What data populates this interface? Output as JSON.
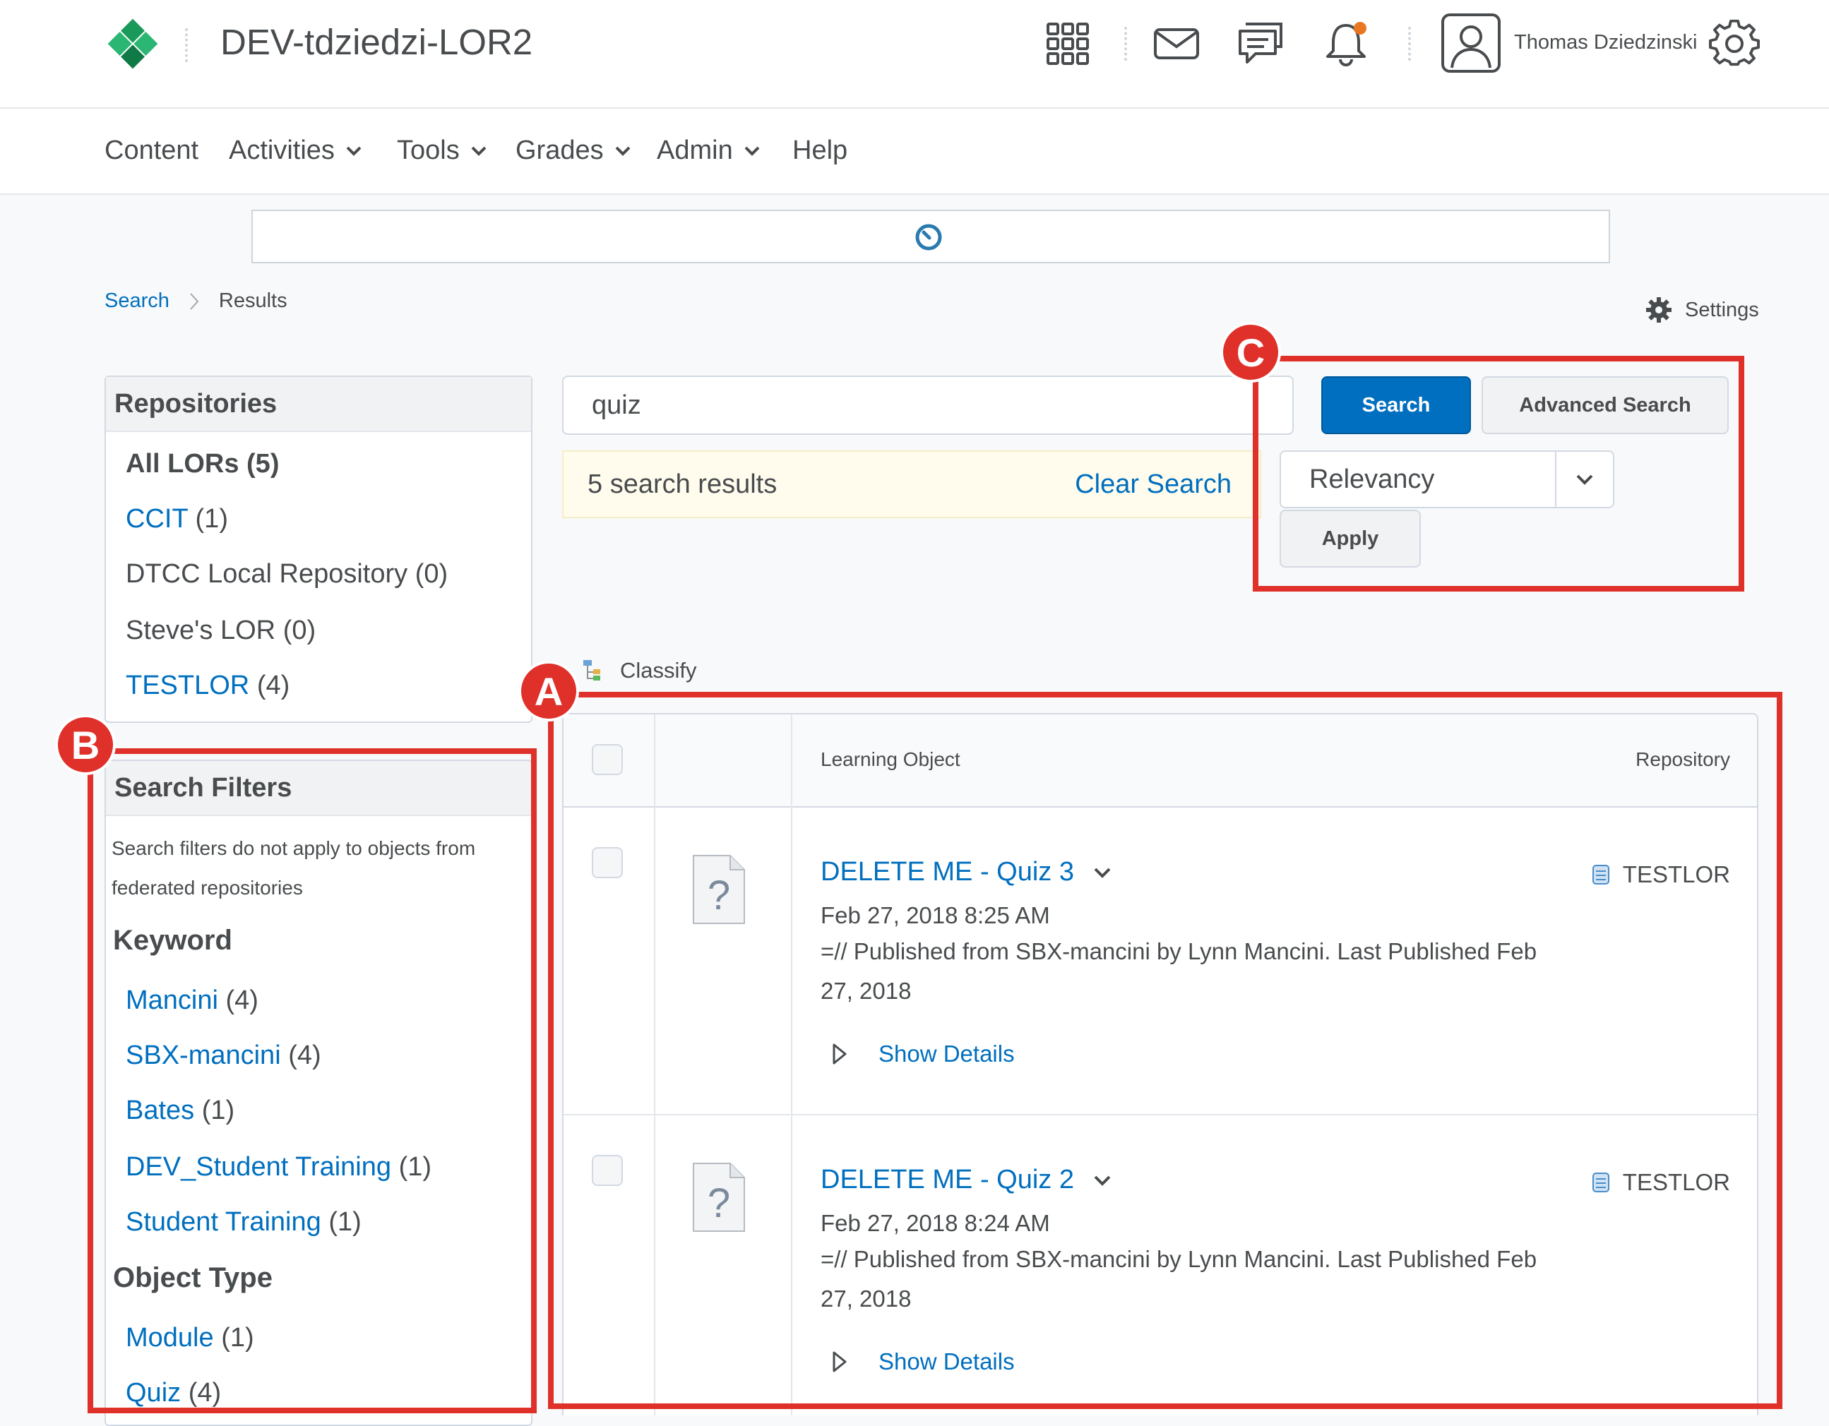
{
  "header": {
    "org_title": "DEV-tdziedzi-LOR2",
    "user_name": "Thomas Dziedzinski",
    "notification_dot_color": "#e87722"
  },
  "nav": {
    "items": [
      {
        "label": "Content",
        "has_menu": false
      },
      {
        "label": "Activities",
        "has_menu": true
      },
      {
        "label": "Tools",
        "has_menu": true
      },
      {
        "label": "Grades",
        "has_menu": true
      },
      {
        "label": "Admin",
        "has_menu": true
      },
      {
        "label": "Help",
        "has_menu": false
      }
    ]
  },
  "breadcrumb": {
    "parent": "Search",
    "current": "Results"
  },
  "settings_label": "Settings",
  "repositories": {
    "title": "Repositories",
    "items": [
      {
        "name": "All LORs",
        "count": "(5)"
      },
      {
        "name": "CCIT",
        "count": "(1)"
      },
      {
        "name": "DTCC Local Repository",
        "count": "(0)"
      },
      {
        "name": "Steve's LOR",
        "count": "(0)"
      },
      {
        "name": "TESTLOR",
        "count": "(4)"
      }
    ]
  },
  "filters": {
    "title": "Search Filters",
    "note": "Search filters do not apply to objects from federated repositories",
    "keyword_heading": "Keyword",
    "keywords": [
      {
        "name": "Mancini",
        "count": "(4)"
      },
      {
        "name": "SBX-mancini",
        "count": "(4)"
      },
      {
        "name": "Bates",
        "count": "(1)"
      },
      {
        "name": "DEV_Student Training",
        "count": "(1)"
      },
      {
        "name": "Student Training",
        "count": "(1)"
      }
    ],
    "object_type_heading": "Object Type",
    "object_types": [
      {
        "name": "Module",
        "count": "(1)"
      },
      {
        "name": "Quiz",
        "count": "(4)"
      }
    ]
  },
  "search": {
    "query": "quiz",
    "search_button": "Search",
    "advanced_button": "Advanced Search",
    "results_count_text": "5 search results",
    "clear_search": "Clear Search",
    "sort_value": "Relevancy",
    "apply_button": "Apply",
    "classify_label": "Classify"
  },
  "table": {
    "col_object": "Learning Object",
    "col_repository": "Repository",
    "rows": [
      {
        "title": "DELETE ME - Quiz 3",
        "date": "Feb 27, 2018 8:25 AM",
        "desc_line1": "=// Published from SBX-mancini by Lynn Mancini. Last Published Feb",
        "desc_line2": "27, 2018",
        "details": "Show Details",
        "repository": "TESTLOR"
      },
      {
        "title": "DELETE ME - Quiz 2",
        "date": "Feb 27, 2018 8:24 AM",
        "desc_line1": "=// Published from SBX-mancini by Lynn Mancini. Last Published Feb",
        "desc_line2": "27, 2018",
        "details": "Show Details",
        "repository": "TESTLOR"
      }
    ]
  },
  "annotations": {
    "a": "A",
    "b": "B",
    "c": "C",
    "color": "#e0302a"
  }
}
